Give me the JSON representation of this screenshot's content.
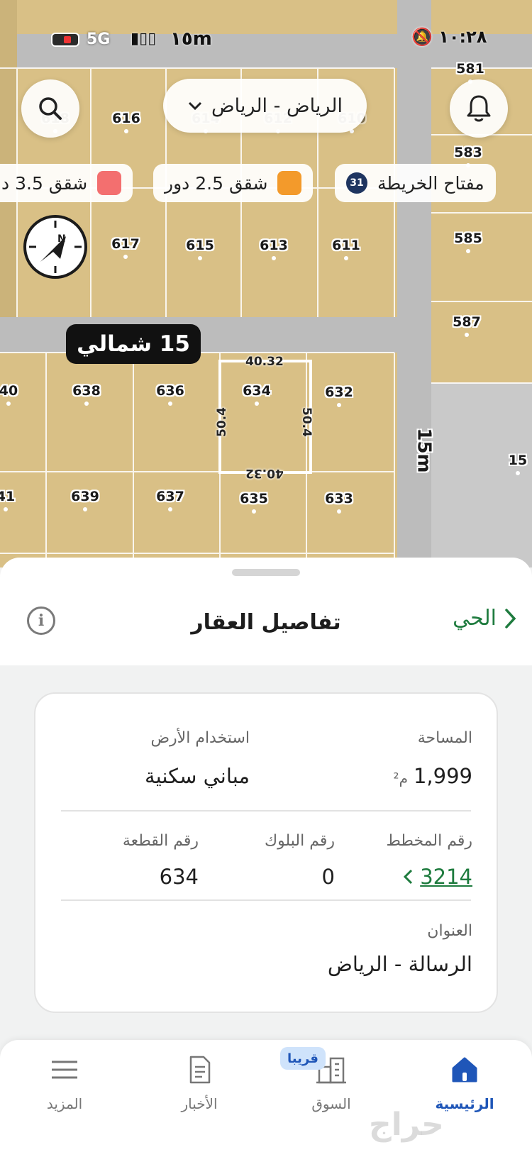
{
  "status_bar": {
    "time": "١٠:٢٨",
    "network": "5G",
    "scale": "١٥m"
  },
  "map": {
    "city_selector": "الرياض - الرياض",
    "legend_chips": [
      {
        "label": "مفتاح الخريطة",
        "badge": "31"
      },
      {
        "label": "شقق 2.5 دور",
        "color": "#f39a2b"
      },
      {
        "label": "شقق 3.5 د",
        "color": "#f36f6f"
      }
    ],
    "street_name": "15 شمالي",
    "street_width_right": "15m",
    "compass_letter": "N",
    "selected_plot": {
      "number": "634",
      "dim_top": "40.32",
      "dim_bottom": "40.32",
      "dim_left": "50.4",
      "dim_right": "50.4"
    },
    "plots": [
      "581",
      "583",
      "585",
      "587",
      "616",
      "617",
      "615",
      "613",
      "611",
      "638",
      "636",
      "634",
      "632",
      "639",
      "637",
      "635",
      "633",
      "40",
      "41",
      "15",
      "614",
      "612",
      "610",
      "618"
    ]
  },
  "sheet": {
    "title": "تفاصيل العقار",
    "back_label": "الحي",
    "info_icon_text": "i",
    "area_label": "المساحة",
    "area_value": "1,999",
    "area_unit": "م²",
    "land_use_label": "استخدام الأرض",
    "land_use_value": "مباني سكنية",
    "scheme_label": "رقم المخطط",
    "scheme_value": "3214",
    "block_label": "رقم البلوك",
    "block_value": "0",
    "plot_label": "رقم القطعة",
    "plot_value": "634",
    "address_label": "العنوان",
    "address_value": "الرسالة - الرياض"
  },
  "tabbar": {
    "home": "الرئيسية",
    "market": "السوق",
    "market_badge": "قريبا",
    "news": "الأخبار",
    "more": "المزيد"
  },
  "watermark": "حراج",
  "colors": {
    "accent_green": "#1e7b3e",
    "tab_active_blue": "#1f56b8",
    "map_land": "#d9c086"
  }
}
